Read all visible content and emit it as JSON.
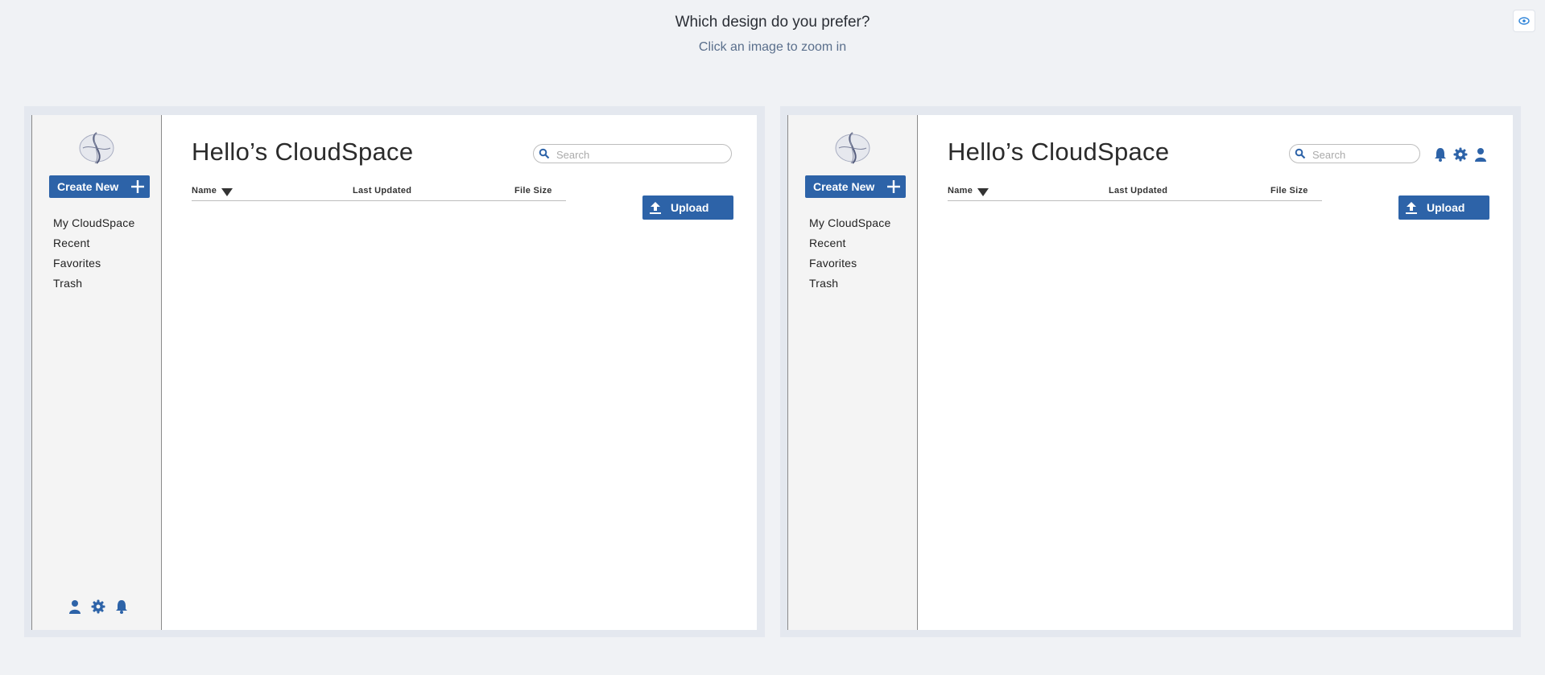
{
  "header": {
    "question": "Which design do you prefer?",
    "hint": "Click an image to zoom in",
    "toggle_icon": "eye-icon"
  },
  "colors": {
    "accent": "#2d63a8",
    "sidebar_bg": "#f4f4f4",
    "page_bg": "#f0f2f5"
  },
  "designs": [
    {
      "title": "Hello’s CloudSpace",
      "create_label": "Create New",
      "nav": [
        "My CloudSpace",
        "Recent",
        "Favorites",
        "Trash"
      ],
      "search_placeholder": "Search",
      "columns": [
        "Name",
        "Last Updated",
        "File Size"
      ],
      "upload_label": "Upload",
      "icons": [
        "user-icon",
        "gear-icon",
        "bell-icon"
      ],
      "icon_location": "sidebar-bottom"
    },
    {
      "title": "Hello’s CloudSpace",
      "create_label": "Create New",
      "nav": [
        "My CloudSpace",
        "Recent",
        "Favorites",
        "Trash"
      ],
      "search_placeholder": "Search",
      "columns": [
        "Name",
        "Last Updated",
        "File Size"
      ],
      "upload_label": "Upload",
      "icons": [
        "bell-icon",
        "gear-icon",
        "user-icon"
      ],
      "icon_location": "header-top-right"
    }
  ]
}
